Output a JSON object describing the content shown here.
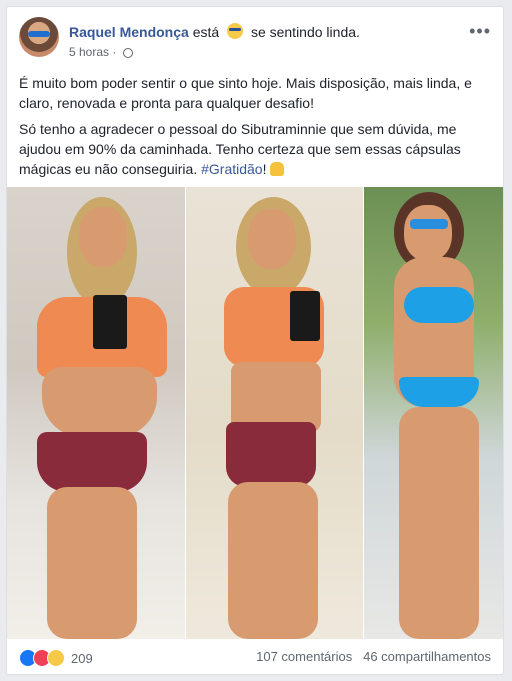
{
  "post": {
    "author": "Raquel Mendonça",
    "feeling_prefix": "está",
    "feeling": "se sentindo linda.",
    "time": "5 horas",
    "paragraph1": "É muito bom poder sentir o que sinto hoje. Mais disposição, mais linda, e claro, renovada e pronta para qualquer desafio!",
    "p2_part1": "Só tenho a agradecer o pessoal do ",
    "p2_tag": "Sibutraminnie",
    "p2_part2": " que sem dúvida, me ajudou em 90% da caminhada. Tenho certeza que sem essas cápsulas mágicas eu não conseguiria. ",
    "hashtag": "#Gratidão",
    "p2_end": "!"
  },
  "footer": {
    "reaction_count": "209",
    "comments": "107 comentários",
    "shares": "46 compartilhamentos"
  },
  "icons": {
    "more": "more-options-icon",
    "privacy": "globe-icon",
    "feeling": "cool-face-icon",
    "reactions": [
      "like-icon",
      "love-icon",
      "wow-icon"
    ]
  },
  "colors": {
    "link": "#385898",
    "like": "#1877f2",
    "love": "#f33e58"
  }
}
